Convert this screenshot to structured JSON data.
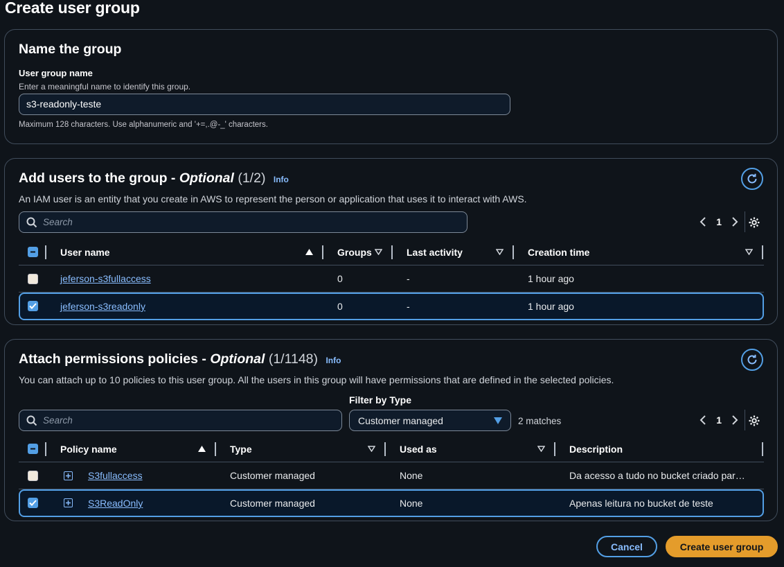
{
  "page": {
    "title": "Create user group"
  },
  "name_section": {
    "title": "Name the group",
    "field_label": "User group name",
    "field_description": "Enter a meaningful name to identify this group.",
    "value": "s3-readonly-teste",
    "constraint": "Maximum 128 characters. Use alphanumeric and '+=,.@-_' characters."
  },
  "users_section": {
    "title": "Add users to the group - ",
    "optional": "Optional",
    "count": "(1/2)",
    "info": "Info",
    "description": "An IAM user is an entity that you create in AWS to represent the person or application that uses it to interact with AWS.",
    "search_placeholder": "Search",
    "page": "1",
    "columns": [
      "User name",
      "Groups",
      "Last activity",
      "Creation time"
    ],
    "rows": [
      {
        "name": "jeferson-s3fullaccess",
        "groups": "0",
        "last_activity": "-",
        "created": "1 hour ago",
        "selected": false
      },
      {
        "name": "jeferson-s3readonly",
        "groups": "0",
        "last_activity": "-",
        "created": "1 hour ago",
        "selected": true
      }
    ]
  },
  "policies_section": {
    "title": "Attach permissions policies - ",
    "optional": "Optional",
    "count": "(1/1148)",
    "info": "Info",
    "description": "You can attach up to 10 policies to this user group. All the users in this group will have permissions that are defined in the selected policies.",
    "search_placeholder": "Search",
    "filter_label": "Filter by Type",
    "filter_value": "Customer managed",
    "matches": "2 matches",
    "page": "1",
    "columns": [
      "Policy name",
      "Type",
      "Used as",
      "Description"
    ],
    "rows": [
      {
        "name": "S3fullaccess",
        "type": "Customer managed",
        "used_as": "None",
        "description": "Da acesso a tudo no bucket criado par…",
        "selected": false
      },
      {
        "name": "S3ReadOnly",
        "type": "Customer managed",
        "used_as": "None",
        "description": "Apenas leitura no bucket de teste",
        "selected": true
      }
    ]
  },
  "footer": {
    "cancel": "Cancel",
    "create": "Create user group"
  },
  "colors": {
    "accent": "#539fe5",
    "link": "#89bdff",
    "primary_button": "#e49c2b",
    "background": "#0f141a"
  }
}
